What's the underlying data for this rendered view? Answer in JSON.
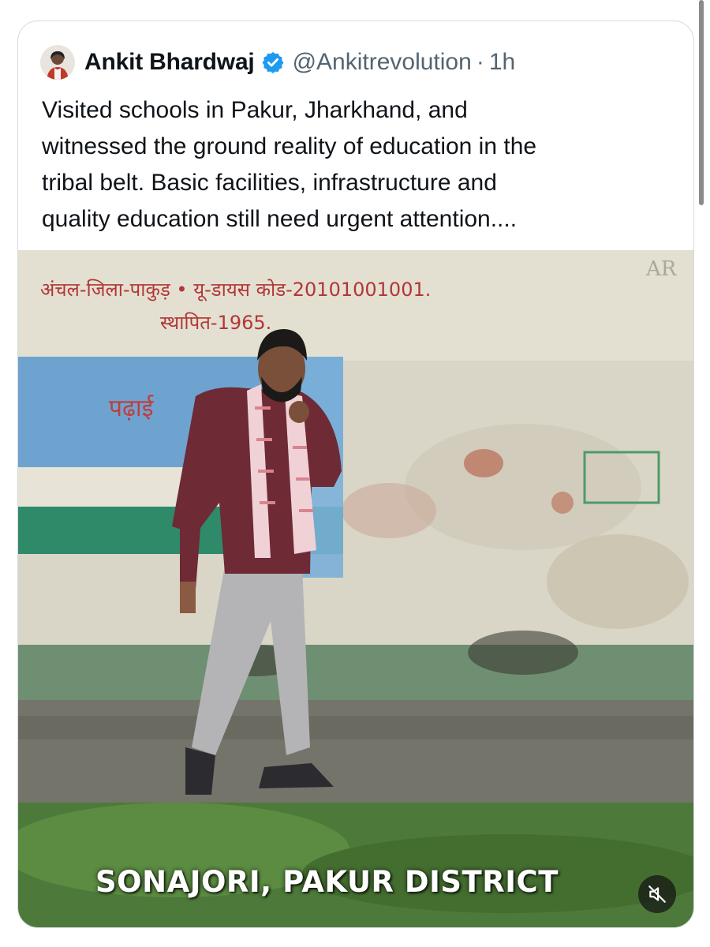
{
  "tweet": {
    "author": {
      "name": "Ankit Bhardwaj",
      "handle": "@Ankitrevolution",
      "separator": "·",
      "time": "1h",
      "verified_color": "#1d9bf0",
      "avatar_icon": "user-avatar-icon"
    },
    "text_lines": [
      "Visited schools in Pakur, Jharkhand, and",
      "witnessed the ground reality of education in the",
      "tribal belt. Basic facilities, infrastructure and",
      "quality education still need urgent attention...."
    ],
    "video": {
      "wall_text_line1": "अंचल-जिला-पाकुड़ • यू-डायस कोड-20101001001.",
      "wall_text_line2": "स्थापित-1965.",
      "mural_text": "पढ़ाई",
      "corner_text": "AR",
      "caption": "SONAJORI, PAKUR DISTRICT",
      "mute_icon": "speaker-muted-icon"
    }
  },
  "colors": {
    "text_primary": "#0f1419",
    "text_secondary": "#536471",
    "border": "#d6dbe0"
  }
}
